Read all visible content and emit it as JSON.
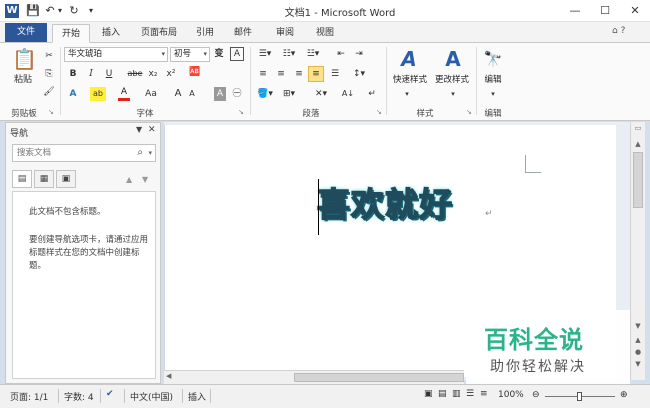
{
  "window": {
    "title": "文档1 - Microsoft Word",
    "logo_letter": "W",
    "controls": {
      "minimize": "—",
      "maximize": "☐",
      "close": "✕"
    }
  },
  "quick_access": {
    "save": "💾",
    "undo": "↶",
    "undo_drop": "▾",
    "redo": "↻",
    "customize": "▾"
  },
  "tabs": {
    "file": "文件",
    "items": [
      "开始",
      "插入",
      "页面布局",
      "引用",
      "邮件",
      "审阅",
      "视图"
    ],
    "active": "开始",
    "help_icons": "⌂ ?"
  },
  "ribbon": {
    "clipboard": {
      "label": "剪贴板",
      "paste": "粘贴",
      "cut": "✂",
      "copy": "⎘",
      "format_painter": "🖌"
    },
    "font": {
      "label": "字体",
      "font_name": "华文琥珀",
      "font_size": "初号",
      "bold": "B",
      "italic": "I",
      "underline": "U",
      "strike": "abe",
      "subscript": "x₂",
      "superscript": "x²",
      "text_effects": "A",
      "highlight": "ab",
      "font_color": "A",
      "change_case": "Aa",
      "grow": "A",
      "shrink": "A",
      "clear": "A",
      "phonetic": "变",
      "border_char": "A",
      "enclose": "㊀"
    },
    "paragraph": {
      "label": "段落",
      "sort": "A↓",
      "show_marks": "↵"
    },
    "styles": {
      "label": "样式",
      "quick_styles": "快速样式",
      "change_styles": "更改样式"
    },
    "editing": {
      "label": "编辑",
      "button": "编辑"
    }
  },
  "nav": {
    "title": "导航",
    "search_placeholder": "搜索文档",
    "empty_line1": "此文档不包含标题。",
    "empty_line2": "要创建导航选项卡，请通过应用标题样式在您的文档中创建标题。"
  },
  "document": {
    "text": "喜欢就好",
    "para_mark": "↵"
  },
  "watermark": {
    "title": "百科全说",
    "subtitle": "助你轻松解决"
  },
  "status": {
    "page": "页面: 1/1",
    "words": "字数: 4",
    "language": "中文(中国)",
    "mode": "插入",
    "zoom": "100%",
    "zoom_level": 1.0
  },
  "colors": {
    "accent": "#2b579a",
    "watermark_green": "#2bb48a"
  }
}
